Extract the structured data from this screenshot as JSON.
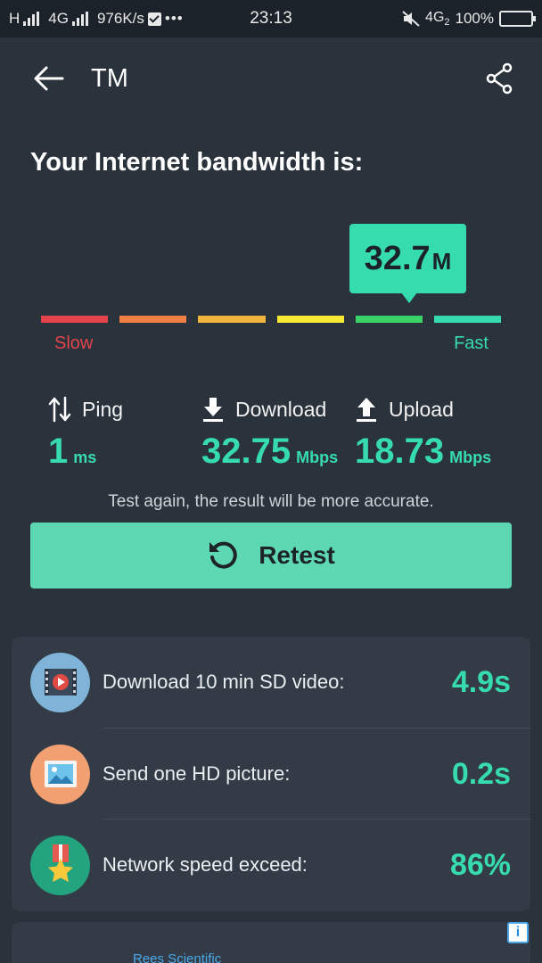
{
  "status_bar": {
    "network_left": "H",
    "network_mid": "4G",
    "speed": "976K/s",
    "more": "•••",
    "time": "23:13",
    "network_right": "4G",
    "network_right_sub": "2",
    "battery": "100%"
  },
  "header": {
    "title": "TM"
  },
  "result": {
    "headline": "Your Internet bandwidth is:",
    "bubble_value": "32.7",
    "bubble_unit": "M",
    "slow_label": "Slow",
    "fast_label": "Fast",
    "scale_colors": [
      "#e3434a",
      "#ee7f45",
      "#f0b53a",
      "#f6ea34",
      "#39d36a",
      "#37dcae"
    ],
    "active_segment_index": 4
  },
  "metrics": {
    "ping": {
      "label": "Ping",
      "value": "1",
      "unit": "ms"
    },
    "download": {
      "label": "Download",
      "value": "32.75",
      "unit": "Mbps"
    },
    "upload": {
      "label": "Upload",
      "value": "18.73",
      "unit": "Mbps"
    }
  },
  "hint": "Test again, the result will be more accurate.",
  "retest_label": "Retest",
  "stats": [
    {
      "label": "Download 10 min SD video:",
      "value": "4.9s",
      "icon": "video-icon",
      "color": "#7fb4d8"
    },
    {
      "label": "Send one HD picture:",
      "value": "0.2s",
      "icon": "picture-icon",
      "color": "#f2a071"
    },
    {
      "label": "Network speed exceed:",
      "value": "86%",
      "icon": "medal-icon",
      "color": "#24a37f"
    }
  ],
  "ad": {
    "info": "i",
    "text": "Rees Scientific"
  },
  "colors": {
    "accent": "#37dcae",
    "button": "#5ed8b3",
    "background": "#2a323c",
    "card": "#323b46"
  }
}
